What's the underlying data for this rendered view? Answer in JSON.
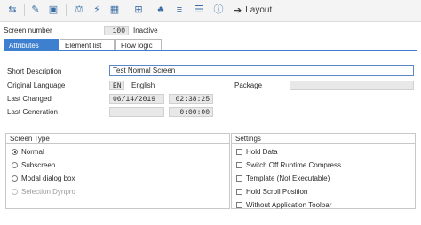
{
  "toolbar": {
    "icons": [
      "back-forward-icon",
      "display-change-icon",
      "activate-icon",
      "check-icon",
      "where-used-icon",
      "object-list-icon",
      "navigation-window-icon",
      "hierarchy-icon",
      "list-icon",
      "settings-list-icon",
      "info-icon"
    ],
    "layout_label": "Layout"
  },
  "screen": {
    "number_label": "Screen number",
    "number_value": "100",
    "status": "Inactive"
  },
  "tabs": [
    "Attributes",
    "Element list",
    "Flow logic"
  ],
  "attributes": {
    "short_description_label": "Short Description",
    "short_description_value": "Test Normal Screen",
    "original_language_label": "Original Language",
    "language_code": "EN",
    "language_name": "English",
    "package_label": "Package",
    "package_value": "",
    "last_changed_label": "Last Changed",
    "last_changed_date": "06/14/2019",
    "last_changed_time": "02:38:25",
    "last_generation_label": "Last Generation",
    "last_generation_date": "",
    "last_generation_time": "0:00:00"
  },
  "screen_type": {
    "title": "Screen Type",
    "options": [
      {
        "label": "Normal",
        "selected": true,
        "enabled": true
      },
      {
        "label": "Subscreen",
        "selected": false,
        "enabled": true
      },
      {
        "label": "Modal dialog box",
        "selected": false,
        "enabled": true
      },
      {
        "label": "Selection Dynpro",
        "selected": false,
        "enabled": false
      }
    ]
  },
  "settings": {
    "title": "Settings",
    "options": [
      "Hold Data",
      "Switch Off Runtime Compress",
      "Template (Not Executable)",
      "Hold Scroll Position",
      "Without Application Toolbar"
    ]
  }
}
